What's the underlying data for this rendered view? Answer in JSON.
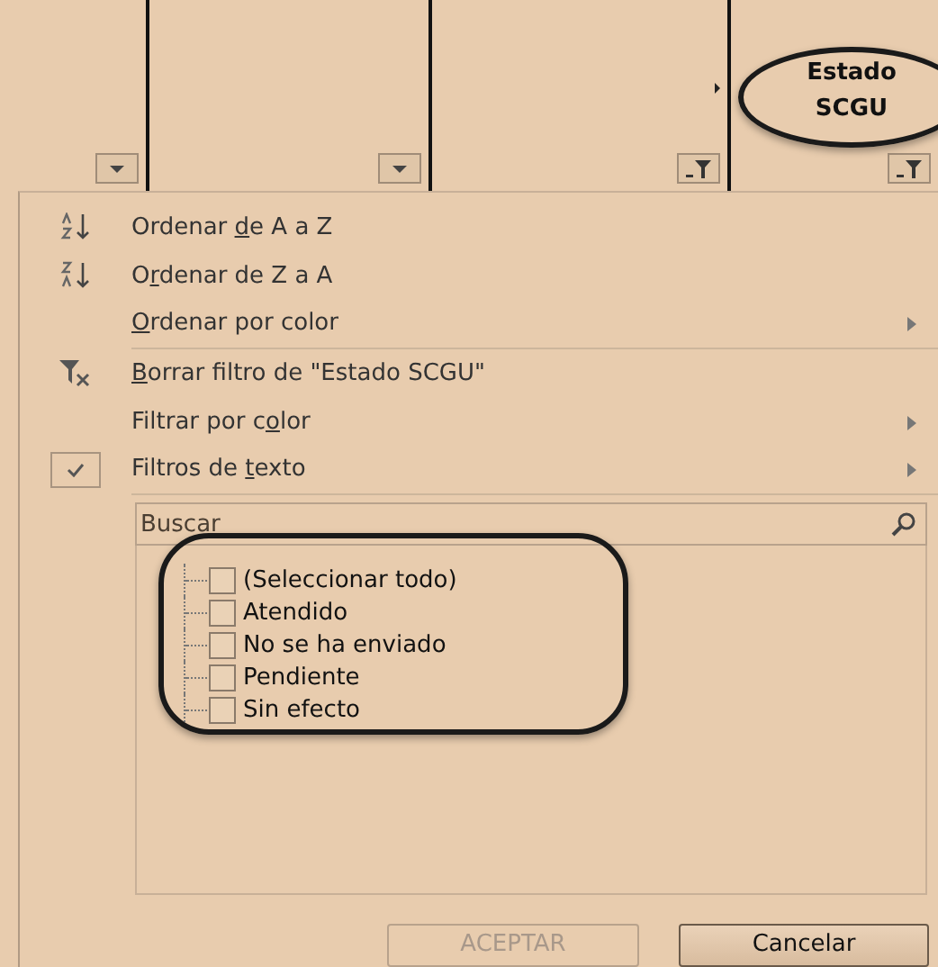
{
  "header": {
    "columns": [
      {
        "kind": "plain"
      },
      {
        "kind": "plain"
      },
      {
        "kind": "filtered"
      },
      {
        "kind": "filtered",
        "label": "Estado SCGU"
      }
    ]
  },
  "menu": {
    "items": [
      {
        "kind": "sort-az",
        "parts": {
          "before": "Ordenar ",
          "key": "d",
          "after": "e A a Z"
        },
        "submenu": false,
        "checked": false
      },
      {
        "kind": "sort-za",
        "parts": {
          "before": "O",
          "key": "r",
          "after": "denar de Z a A"
        },
        "submenu": false,
        "checked": false
      },
      {
        "kind": "plain",
        "parts": {
          "key": "O",
          "after": "rdenar por color"
        },
        "submenu": true,
        "checked": false,
        "separator_after": true
      },
      {
        "kind": "clear-filter",
        "parts": {
          "key": "B",
          "after": "orrar filtro de \"Estado SCGU\""
        },
        "submenu": false,
        "checked": false
      },
      {
        "kind": "plain",
        "parts": {
          "before": "Filtrar por c",
          "key": "o",
          "after": "lor"
        },
        "submenu": true,
        "checked": false
      },
      {
        "kind": "plain",
        "parts": {
          "before": "Filtros de ",
          "key": "t",
          "after": "exto"
        },
        "submenu": true,
        "checked": true,
        "separator_after": true
      }
    ],
    "search": {
      "placeholder": "Buscar"
    },
    "values": [
      {
        "label": "(Seleccionar todo)",
        "checked": false
      },
      {
        "label": "Atendido",
        "checked": false
      },
      {
        "label": "No se ha enviado",
        "checked": false
      },
      {
        "label": "Pendiente",
        "checked": false
      },
      {
        "label": "Sin efecto",
        "checked": false
      }
    ],
    "buttons": [
      {
        "label": "ACEPTAR",
        "disabled": true
      },
      {
        "label": "Cancelar",
        "disabled": false
      }
    ]
  }
}
